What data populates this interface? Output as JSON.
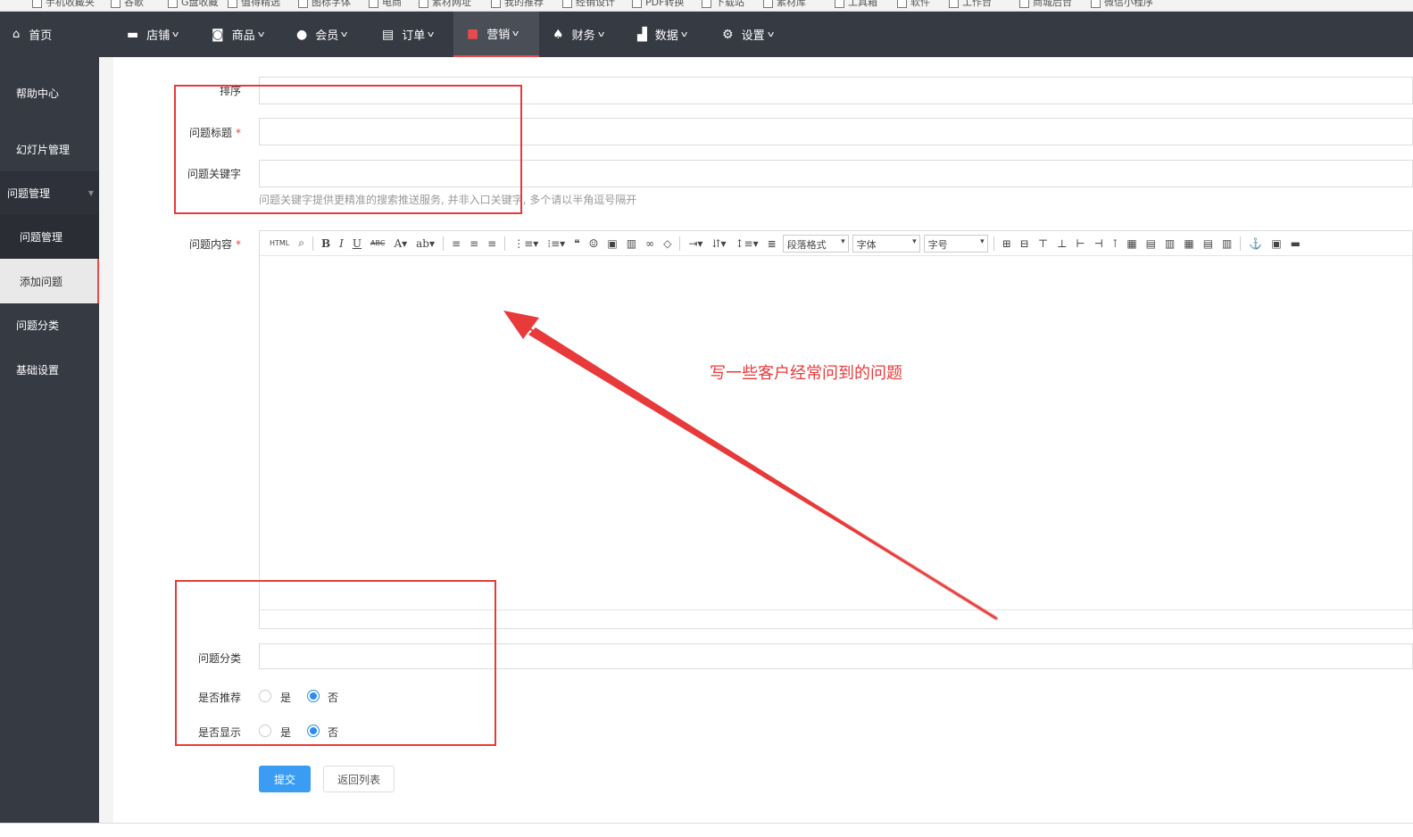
{
  "bookmarks": [
    "手机收藏夹",
    "谷歌",
    "G盘收藏",
    "值得精选",
    "图标字体",
    "电商",
    "素材网址",
    "我的推荐",
    "经销设计",
    "PDF转换",
    "下载站",
    "素材库",
    "工具箱",
    "软件",
    "工作台",
    "商城后台",
    "微信小程序"
  ],
  "nav": {
    "home": "首页",
    "items": [
      {
        "label": "店铺",
        "icon": "store-icon"
      },
      {
        "label": "商品",
        "icon": "goods-icon"
      },
      {
        "label": "会员",
        "icon": "member-icon"
      },
      {
        "label": "订单",
        "icon": "order-icon"
      },
      {
        "label": "营销",
        "icon": "gift-icon"
      },
      {
        "label": "财务",
        "icon": "money-bag-icon"
      },
      {
        "label": "数据",
        "icon": "chart-icon"
      },
      {
        "label": "设置",
        "icon": "gear-icon"
      }
    ],
    "active_color": "#e84b4b"
  },
  "sidebar": {
    "items": [
      "帮助中心",
      "幻灯片管理",
      "问题管理",
      "问题管理",
      "添加问题",
      "问题分类",
      "基础设置"
    ]
  },
  "form": {
    "sort_label": "排序",
    "title_label": "问题标题",
    "keyword_label": "问题关键字",
    "keyword_hint": "问题关键字提供更精准的搜索推送服务, 并非入口关键字, 多个请以半角逗号隔开",
    "content_label": "问题内容",
    "category_label": "问题分类",
    "recommend_label": "是否推荐",
    "display_label": "是否显示",
    "yes": "是",
    "no": "否",
    "recommend_value": "否",
    "display_value": "否",
    "required_mark": "*"
  },
  "editor": {
    "html_btn": "HTML",
    "paragraph": "段落格式",
    "font": "字体",
    "size": "字号"
  },
  "buttons": {
    "submit": "提交",
    "back": "返回列表"
  },
  "annotation": {
    "text": "写一些客户经常问到的问题",
    "color": "#e83a3a"
  }
}
